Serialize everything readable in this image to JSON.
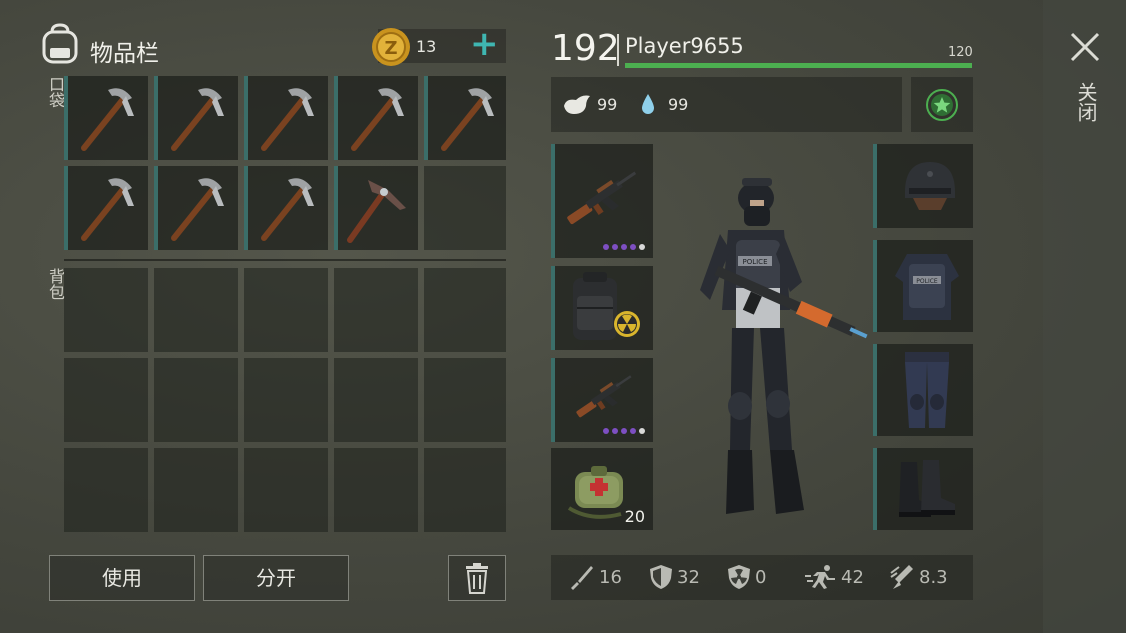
{
  "inventory": {
    "title": "物品栏",
    "coins": "13",
    "add_label": "+",
    "pocket_label": "口袋",
    "backpack_label": "背包"
  },
  "actions": {
    "use_label": "使用",
    "split_label": "分开"
  },
  "player": {
    "level": "192",
    "name": "Player9655",
    "xp_max": "120",
    "xp_progress": 1.0,
    "hunger": "99",
    "water": "99"
  },
  "equipment": {
    "medkit_count": "20"
  },
  "stats": {
    "attack": "16",
    "defense": "32",
    "radiation": "0",
    "speed": "42",
    "stealth": "8.3"
  },
  "close_label": "关闭",
  "colors": {
    "accent": "#3b6e69",
    "xp_bar": "#4caf50",
    "rarity_dot": "#7d4fc2"
  }
}
